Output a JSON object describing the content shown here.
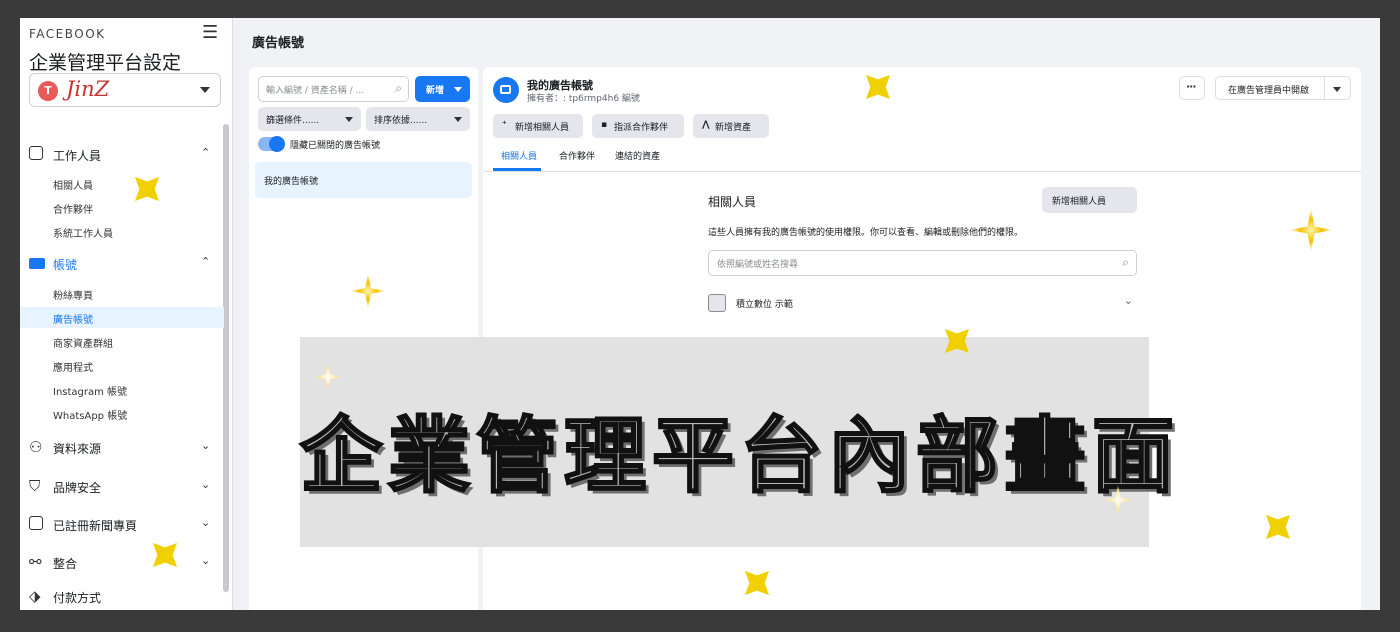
{
  "sidebar": {
    "brand": "FACEBOOK",
    "title": "企業管理平台設定",
    "business": {
      "initial": "T",
      "name": "JinZ"
    },
    "sections": [
      {
        "label": "工作人員",
        "icon": "person-badge-icon",
        "expanded": true,
        "items": [
          "相關人員",
          "合作夥伴",
          "系統工作人員"
        ]
      },
      {
        "label": "帳號",
        "icon": "briefcase-icon",
        "expanded": true,
        "active": true,
        "items": [
          "粉絲專頁",
          "廣告帳號",
          "商家資產群組",
          "應用程式",
          "Instagram 帳號",
          "WhatsApp 帳號"
        ],
        "active_item": "廣告帳號"
      },
      {
        "label": "資料來源",
        "icon": "data-sources-icon",
        "expanded": false
      },
      {
        "label": "品牌安全",
        "icon": "shield-icon",
        "expanded": false
      },
      {
        "label": "已註冊新聞專頁",
        "icon": "clipboard-icon",
        "expanded": false
      },
      {
        "label": "整合",
        "icon": "integrations-icon",
        "expanded": false
      },
      {
        "label": "付款方式",
        "icon": "payment-tag-icon",
        "expanded": false
      }
    ]
  },
  "header": {
    "title": "廣告帳號"
  },
  "list_panel": {
    "search_placeholder": "輸入編號 / 資產名稱 / ...",
    "add_label": "新增",
    "filter_label": "篩選條件......",
    "sort_label": "排序依據......",
    "toggle_label": "隱藏已關閉的廣告帳號",
    "items": [
      "我的廣告帳號"
    ]
  },
  "detail": {
    "title": "我的廣告帳號",
    "owner": "擁有者：: tp6rmp4h6  編號",
    "actions": [
      "新增相關人員",
      "指派合作夥伴",
      "新增資產"
    ],
    "tabs": [
      "相關人員",
      "合作夥伴",
      "連結的資產"
    ],
    "more_label": "···",
    "open_label": "在廣告管理員中開啟",
    "people_title": "相關人員",
    "add_person_label": "新增相關人員",
    "people_desc": "這些人員擁有我的廣告帳號的使用權限。你可以查看、編輯或刪除他們的權限。",
    "people_search_placeholder": "依照編號或姓名搜尋",
    "people": [
      {
        "name": "積立數位 示範"
      }
    ]
  },
  "overlay": {
    "text": "企業管理平台內部畫面"
  },
  "colors": {
    "accent": "#1877f2",
    "sparkle": "#f0d000"
  }
}
